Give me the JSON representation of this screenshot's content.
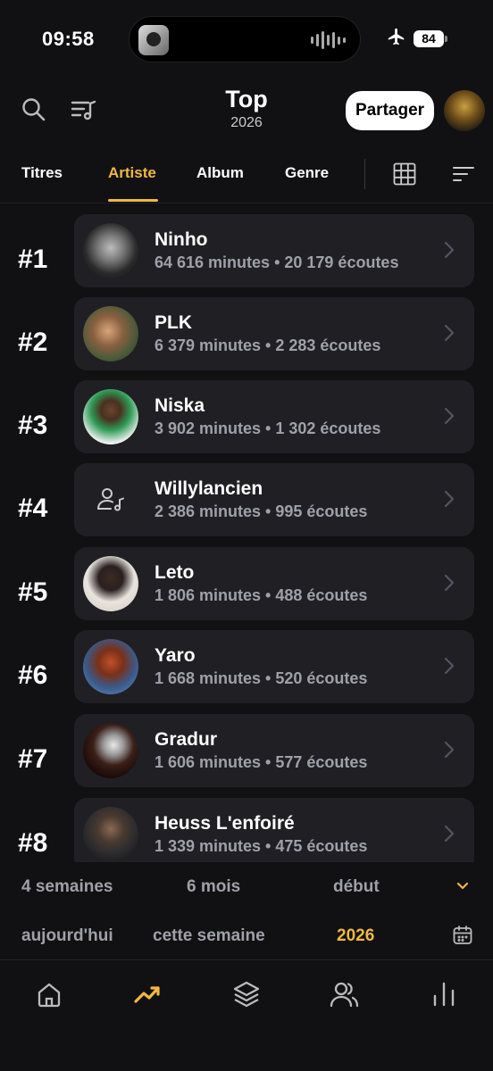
{
  "status_bar": {
    "time": "09:58",
    "battery": "84",
    "plane_icon": "airplane-icon"
  },
  "header": {
    "title": "Top",
    "subtitle": "2026",
    "share_label": "Partager"
  },
  "tabs": [
    {
      "label": "Titres",
      "active": false
    },
    {
      "label": "Artiste",
      "active": true
    },
    {
      "label": "Album",
      "active": false
    },
    {
      "label": "Genre",
      "active": false
    }
  ],
  "artists": [
    {
      "rank": "#1",
      "name": "Ninho",
      "stats": "64 616 minutes • 20 179 écoutes",
      "thumb": "dark"
    },
    {
      "rank": "#2",
      "name": "PLK",
      "stats": "6 379 minutes • 2 283 écoutes",
      "thumb": "warm"
    },
    {
      "rank": "#3",
      "name": "Niska",
      "stats": "3 902 minutes • 1 302 écoutes",
      "thumb": "green"
    },
    {
      "rank": "#4",
      "name": "Willylancien",
      "stats": "2 386 minutes • 995 écoutes",
      "thumb": "none"
    },
    {
      "rank": "#5",
      "name": "Leto",
      "stats": "1 806 minutes • 488 écoutes",
      "thumb": "light"
    },
    {
      "rank": "#6",
      "name": "Yaro",
      "stats": "1 668 minutes • 520 écoutes",
      "thumb": "blue"
    },
    {
      "rank": "#7",
      "name": "Gradur",
      "stats": "1 606 minutes • 577 écoutes",
      "thumb": "night"
    },
    {
      "rank": "#8",
      "name": "Heuss L'enfoiré",
      "stats": "1 339 minutes • 475 écoutes",
      "thumb": "grey"
    }
  ],
  "periods": {
    "row1": [
      "4 semaines",
      "6 mois",
      "début"
    ],
    "row2": [
      "aujourd'hui",
      "cette semaine",
      "2026"
    ],
    "active": "2026"
  },
  "colors": {
    "accent": "#f0b840",
    "background": "#111114",
    "card": "#1f1f24",
    "muted": "#a0a0a8"
  },
  "nav": [
    "home-icon",
    "trending-icon",
    "layers-icon",
    "friends-icon",
    "stats-icon"
  ],
  "nav_active": "trending-icon"
}
